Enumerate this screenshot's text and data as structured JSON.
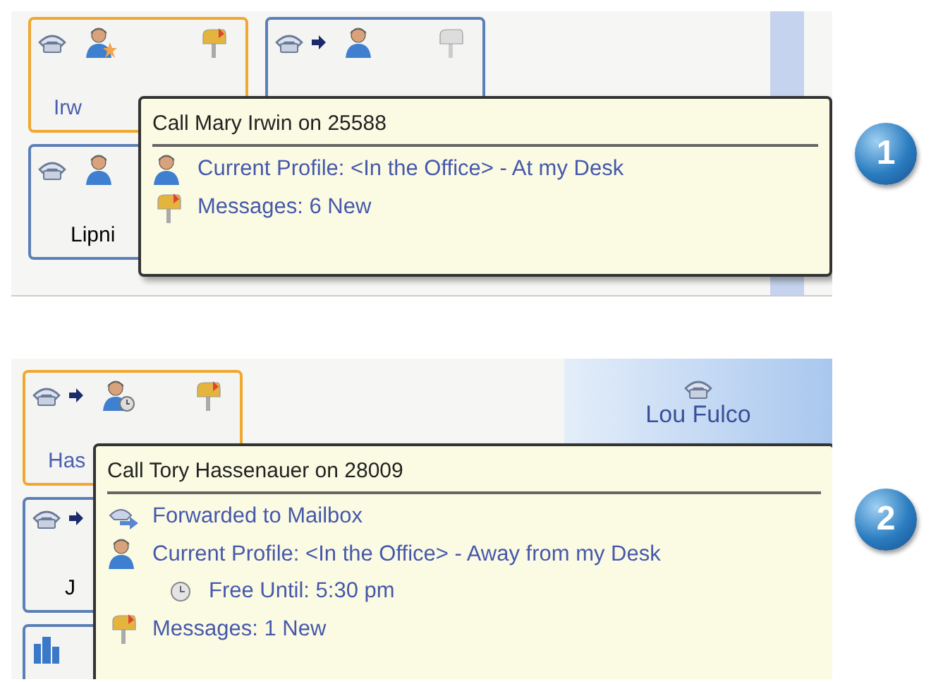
{
  "panels": [
    {
      "number": "1",
      "cards": [
        {
          "kind": "contact",
          "label": "Irw",
          "selected": true,
          "forwarded": false
        },
        {
          "kind": "contact",
          "selected": false,
          "forwarded": true
        },
        {
          "kind": "contact",
          "label": "Lipni",
          "selected": false,
          "forwarded": false,
          "covered": true
        }
      ],
      "tooltip": {
        "title": "Call Mary Irwin on 25588",
        "lines": [
          {
            "kind": "profile",
            "text": "Current Profile: <In the Office> - At my Desk"
          },
          {
            "kind": "messages",
            "text": "Messages: 6 New"
          }
        ]
      }
    },
    {
      "number": "2",
      "side": {
        "label": "Lou Fulco"
      },
      "cards": [
        {
          "kind": "contact",
          "label": "Has",
          "selected": true,
          "forwarded": true
        },
        {
          "kind": "contact",
          "label": "J",
          "selected": false,
          "forwarded": true,
          "covered": true
        },
        {
          "kind": "group",
          "selected": false,
          "forwarded": false
        }
      ],
      "tooltip": {
        "title": "Call Tory Hassenauer on 28009",
        "lines": [
          {
            "kind": "forward",
            "text": "Forwarded to Mailbox"
          },
          {
            "kind": "profile",
            "text": "Current Profile: <In the Office> - Away from my Desk"
          },
          {
            "kind": "free",
            "text": "Free Until: 5:30 pm"
          },
          {
            "kind": "messages",
            "text": "Messages: 1 New"
          }
        ]
      }
    }
  ]
}
